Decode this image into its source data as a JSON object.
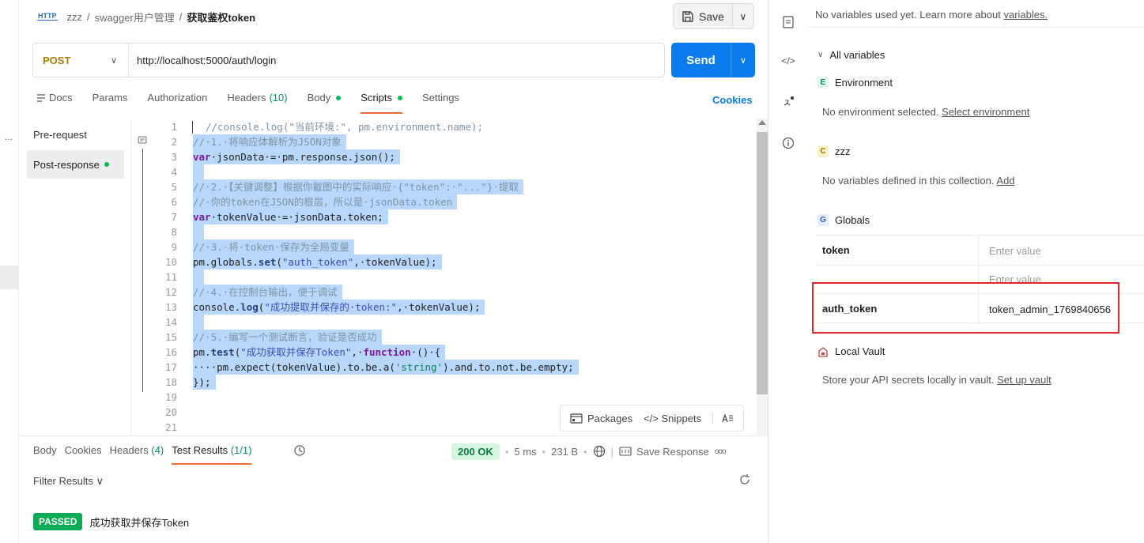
{
  "breadcrumb": {
    "icon_text": "HTTP",
    "collection": "zzz",
    "folder": "swagger用户管理",
    "request": "获取鉴权token",
    "sep": "/"
  },
  "save": {
    "label": "Save",
    "caret": "∨"
  },
  "request": {
    "method": "POST",
    "method_caret": "∨",
    "url": "http://localhost:5000/auth/login",
    "send_label": "Send",
    "send_caret": "∨"
  },
  "tabs": {
    "docs": "Docs",
    "params": "Params",
    "authorization": "Authorization",
    "headers": "Headers",
    "headers_count": "(10)",
    "body": "Body",
    "scripts": "Scripts",
    "settings": "Settings",
    "cookies": "Cookies"
  },
  "scripts_sidebar": {
    "pre": "Pre-request",
    "post": "Post-response"
  },
  "left_strip": {
    "dots": "..."
  },
  "code_lines": [
    "//console.log(\"当前环境:\", pm.environment.name);",
    "//·1.·将响应体解析为JSON对象",
    "var·jsonData·=·pm.response.json();",
    "",
    "//·2.·【关键调整】根据你截图中的实际响应·{\"token\":·\"...\"}·提取",
    "//·你的token在JSON的根层，所以是·jsonData.token",
    "var·tokenValue·=·jsonData.token;",
    "",
    "//·3.·将·token·保存为全局变量",
    "pm.globals.set(\"auth_token\",·tokenValue);",
    "",
    "//·4.·在控制台输出，便于调试",
    "console.log(\"成功提取并保存的·token:\",·tokenValue);",
    "",
    "//·5.·编写一个测试断言，验证是否成功",
    "pm.test(\"成功获取并保存Token\",·function·()·{",
    "····pm.expect(tokenValue).to.be.a('string').and.to.not.be.empty;",
    "});",
    "",
    "",
    ""
  ],
  "line_numbers": [
    "1",
    "2",
    "3",
    "4",
    "5",
    "6",
    "7",
    "8",
    "9",
    "10",
    "11",
    "12",
    "13",
    "14",
    "15",
    "16",
    "17",
    "18",
    "19",
    "20",
    "21"
  ],
  "editor_tools": {
    "packages": "Packages",
    "snippets": "</> Snippets",
    "ai_icon": "ai-format-icon"
  },
  "response": {
    "tabs": {
      "body": "Body",
      "cookies": "Cookies",
      "headers": "Headers",
      "headers_count": "(4)",
      "test_results": "Test Results",
      "test_count": "(1/1)"
    },
    "status": "200 OK",
    "time": "5 ms",
    "size": "231 B",
    "save_response": "Save Response",
    "more": "ooo",
    "filter": "Filter Results ∨",
    "test": {
      "badge": "PASSED",
      "name": "成功获取并保存Token"
    }
  },
  "variables": {
    "top_text": "No variables used yet. Learn more about ",
    "top_link": "variables.",
    "all_variables": "All variables",
    "environment": {
      "badge": "E",
      "title": "Environment",
      "text": "No environment selected. ",
      "link": "Select environment"
    },
    "collection": {
      "badge": "C",
      "title": "zzz",
      "text": "No variables defined in this collection. ",
      "link": "Add"
    },
    "globals": {
      "badge": "G",
      "title": "Globals",
      "rows": [
        {
          "key": "token",
          "value": "Enter value"
        },
        {
          "key": "",
          "value": "Enter value"
        },
        {
          "key": "auth_token",
          "value": "token_admin_1769840656"
        }
      ]
    },
    "vault": {
      "title": "Local Vault",
      "text": "Store your API secrets locally in vault. ",
      "link": "Set up vault"
    }
  },
  "colors": {
    "accent": "#097bed",
    "tab_underline": "#f26b3a",
    "success": "#0cab55",
    "highlight_box": "#e0242b",
    "method": "#ad7a03"
  }
}
